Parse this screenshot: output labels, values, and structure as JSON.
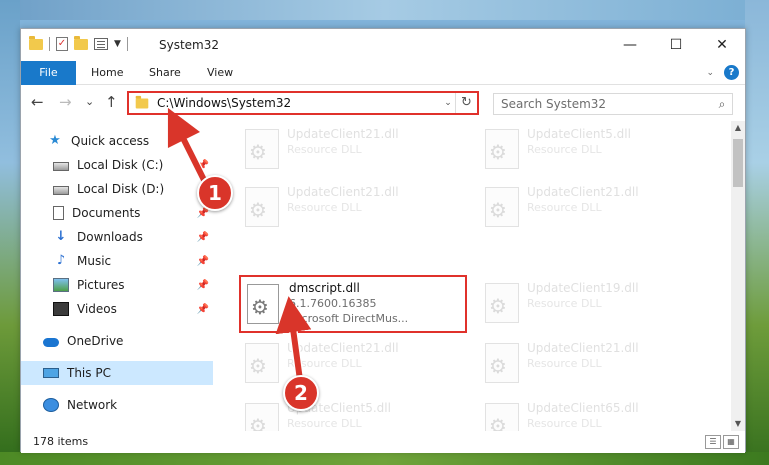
{
  "window": {
    "title": "System32",
    "controls": {
      "minimize": "—",
      "maximize": "☐",
      "close": "✕"
    }
  },
  "ribbon": {
    "tabs": [
      "File",
      "Home",
      "Share",
      "View"
    ],
    "help": "?"
  },
  "navigation": {
    "back": "←",
    "forward": "→",
    "recent": "⌄",
    "up": "↑",
    "address": "C:\\Windows\\System32",
    "search_placeholder": "Search System32"
  },
  "sidebar": {
    "items": [
      {
        "label": "Quick access",
        "icon": "quick-access-star-icon",
        "pinned": false
      },
      {
        "label": "Local Disk (C:)",
        "icon": "drive-icon",
        "pinned": true
      },
      {
        "label": "Local Disk (D:)",
        "icon": "drive-icon",
        "pinned": true
      },
      {
        "label": "Documents",
        "icon": "documents-icon",
        "pinned": true
      },
      {
        "label": "Downloads",
        "icon": "downloads-icon",
        "pinned": true
      },
      {
        "label": "Music",
        "icon": "music-icon",
        "pinned": true
      },
      {
        "label": "Pictures",
        "icon": "pictures-icon",
        "pinned": true
      },
      {
        "label": "Videos",
        "icon": "videos-icon",
        "pinned": true
      },
      {
        "label": "OneDrive",
        "icon": "onedrive-icon",
        "pinned": false
      },
      {
        "label": "This PC",
        "icon": "this-pc-icon",
        "pinned": false,
        "selected": true
      },
      {
        "label": "Network",
        "icon": "network-icon",
        "pinned": false
      }
    ]
  },
  "files": {
    "background_tiles": [
      {
        "name": "UpdateClient21.dll",
        "type": "Resource DLL"
      },
      {
        "name": "UpdateClient5.dll",
        "type": "Resource DLL"
      },
      {
        "name": "UpdateClient21.dll",
        "type": "Resource DLL"
      },
      {
        "name": "UpdateClient21.dll",
        "type": "Resource DLL"
      },
      {
        "name": "UpdateClient19.dll",
        "type": "Resource DLL"
      },
      {
        "name": "UpdateClient21.dll",
        "type": "Resource DLL"
      },
      {
        "name": "UpdateClient21.dll",
        "type": "Resource DLL"
      },
      {
        "name": "UpdateClient5.dll",
        "type": "Resource DLL"
      },
      {
        "name": "UpdateClient65.dll",
        "type": "Resource DLL"
      }
    ],
    "highlighted": {
      "name": "dmscript.dll",
      "version": "6.1.7600.16385",
      "description": "Microsoft DirectMus..."
    }
  },
  "status": {
    "item_count": "178 items"
  },
  "callouts": {
    "one": "1",
    "two": "2"
  },
  "colors": {
    "accent": "#1979ca",
    "callout_red": "#d9352a",
    "highlight_border": "#e0312b",
    "selected_bg": "#cce8ff"
  }
}
